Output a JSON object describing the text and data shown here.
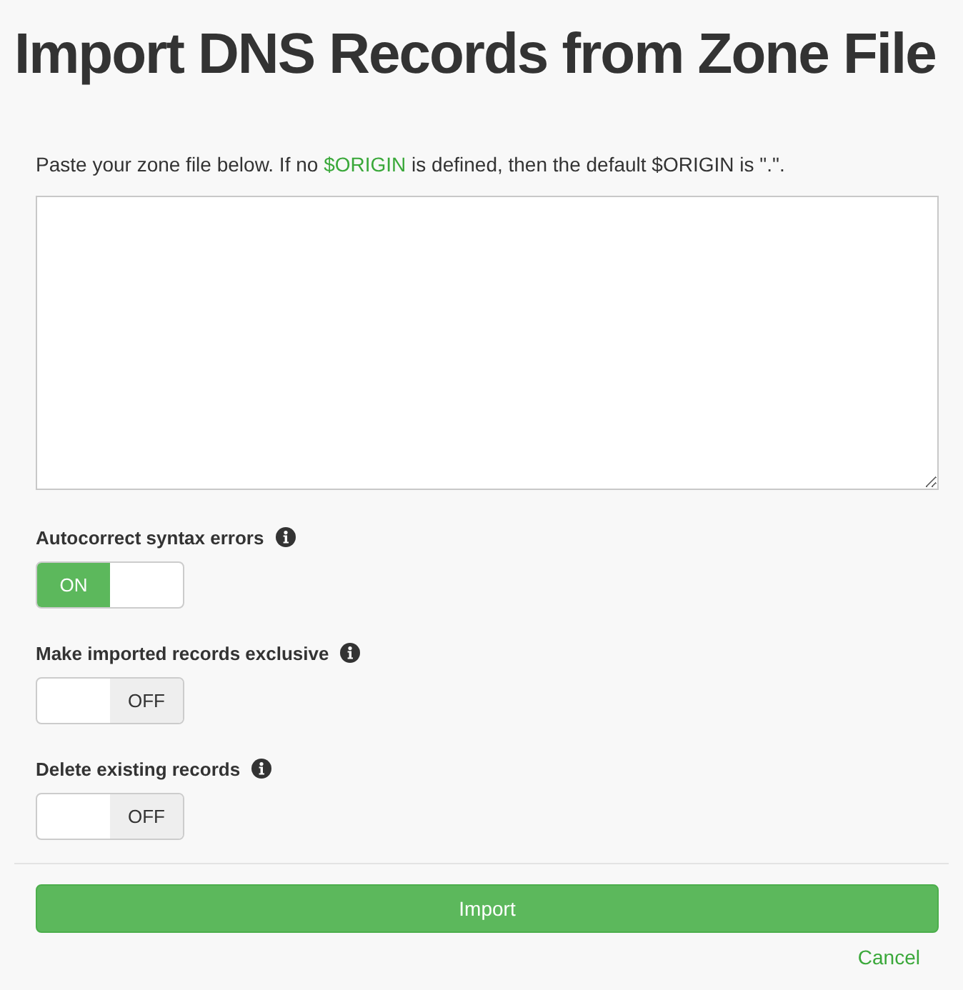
{
  "title": "Import DNS Records from Zone File",
  "intro": {
    "before": "Paste your zone file below. If no ",
    "link": "$ORIGIN",
    "after": " is defined, then the default $ORIGIN is \".\"."
  },
  "options": [
    {
      "label": "Autocorrect syntax errors",
      "on": true,
      "switch_text": "ON"
    },
    {
      "label": "Make imported records exclusive",
      "on": false,
      "switch_text": "OFF"
    },
    {
      "label": "Delete existing records",
      "on": false,
      "switch_text": "OFF"
    }
  ],
  "import_button": "Import",
  "cancel_link": "Cancel"
}
